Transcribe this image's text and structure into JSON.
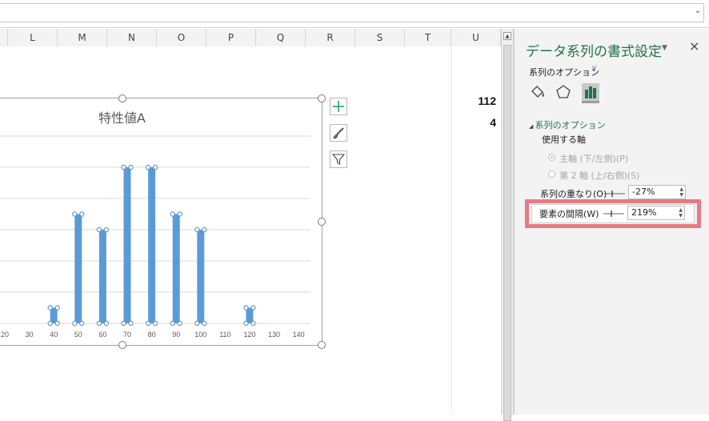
{
  "columns": [
    "L",
    "M",
    "N",
    "O",
    "P",
    "Q",
    "R",
    "S",
    "T",
    "U"
  ],
  "cells": {
    "u_value_1": "112",
    "u_value_2": "4"
  },
  "chart": {
    "title": "特性値A",
    "buttons": [
      "plus-icon",
      "brush-icon",
      "filter-icon"
    ]
  },
  "chart_data": {
    "type": "bar",
    "title": "特性値A",
    "xlabel": "",
    "ylabel": "",
    "x_ticks": [
      "20",
      "30",
      "40",
      "50",
      "60",
      "70",
      "80",
      "90",
      "100",
      "110",
      "120",
      "130",
      "140"
    ],
    "categories": [
      40,
      50,
      60,
      70,
      80,
      90,
      100,
      120
    ],
    "values": [
      1,
      7,
      6,
      10,
      10,
      7,
      6,
      1
    ],
    "ylim": [
      0,
      12
    ],
    "grid": true,
    "accent": "#5b9bd5"
  },
  "pane": {
    "title": "データ系列の書式設定",
    "close": "×",
    "options_label": "系列のオプション",
    "section_title": "系列のオプション",
    "axis_label": "使用する軸",
    "primary_axis": "主軸 (下/左側)(P)",
    "secondary_axis": "第 2 軸 (上/右側)(S)",
    "overlap_label": "系列の重なり(O)",
    "overlap_value": "-27%",
    "gap_label": "要素の間隔(W)",
    "gap_value": "219%"
  },
  "colors": {
    "accent_green": "#217346",
    "highlight": "#e77a85",
    "bar": "#5b9bd5"
  }
}
